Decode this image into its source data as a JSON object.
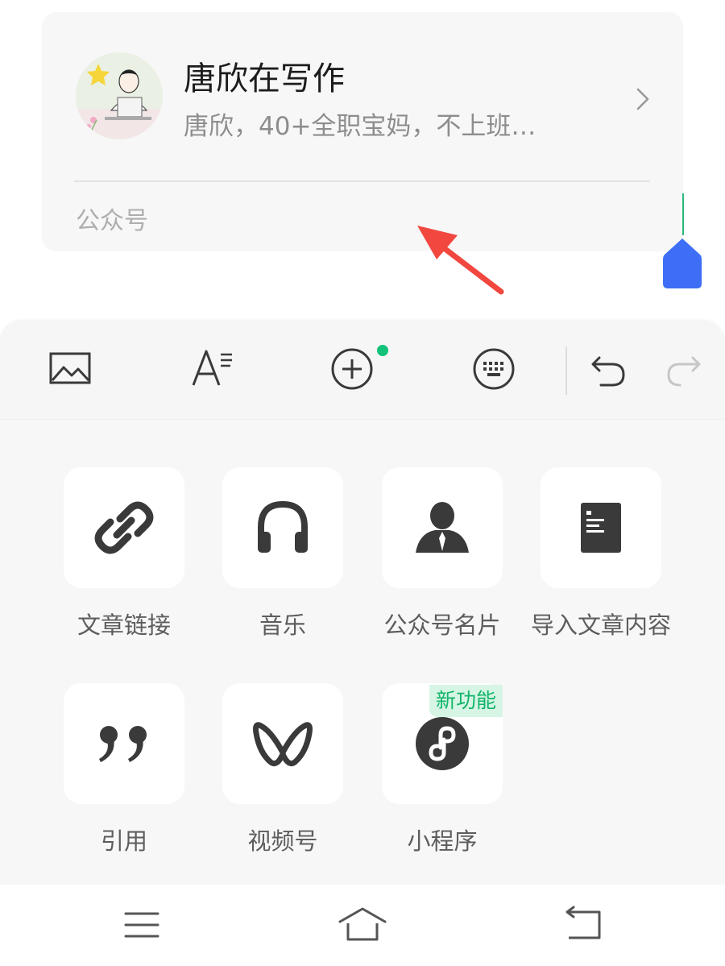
{
  "account_card": {
    "name": "唐欣在写作",
    "description": "唐欣，40+全职宝妈，不上班…",
    "type_label": "公众号"
  },
  "toolbar": {
    "items": [
      "image-icon",
      "text-format-icon",
      "insert-plus-icon",
      "keyboard-icon",
      "undo-icon",
      "redo-icon"
    ],
    "insert_has_dot": true
  },
  "insert_menu": {
    "items": [
      {
        "label": "文章链接",
        "icon": "link-icon"
      },
      {
        "label": "音乐",
        "icon": "headphones-icon"
      },
      {
        "label": "公众号名片",
        "icon": "person-card-icon"
      },
      {
        "label": "导入文章内容",
        "icon": "document-icon"
      },
      {
        "label": "引用",
        "icon": "quote-icon"
      },
      {
        "label": "视频号",
        "icon": "channels-icon"
      },
      {
        "label": "小程序",
        "icon": "mini-program-icon",
        "badge": "新功能"
      }
    ]
  },
  "nav": [
    "menu-icon",
    "home-icon",
    "back-icon"
  ],
  "colors": {
    "accent_green": "#13c27a",
    "cursor_blue": "#3d6ef5",
    "annotation_red": "#f2473f",
    "icon_dark": "#3a3a3a"
  }
}
